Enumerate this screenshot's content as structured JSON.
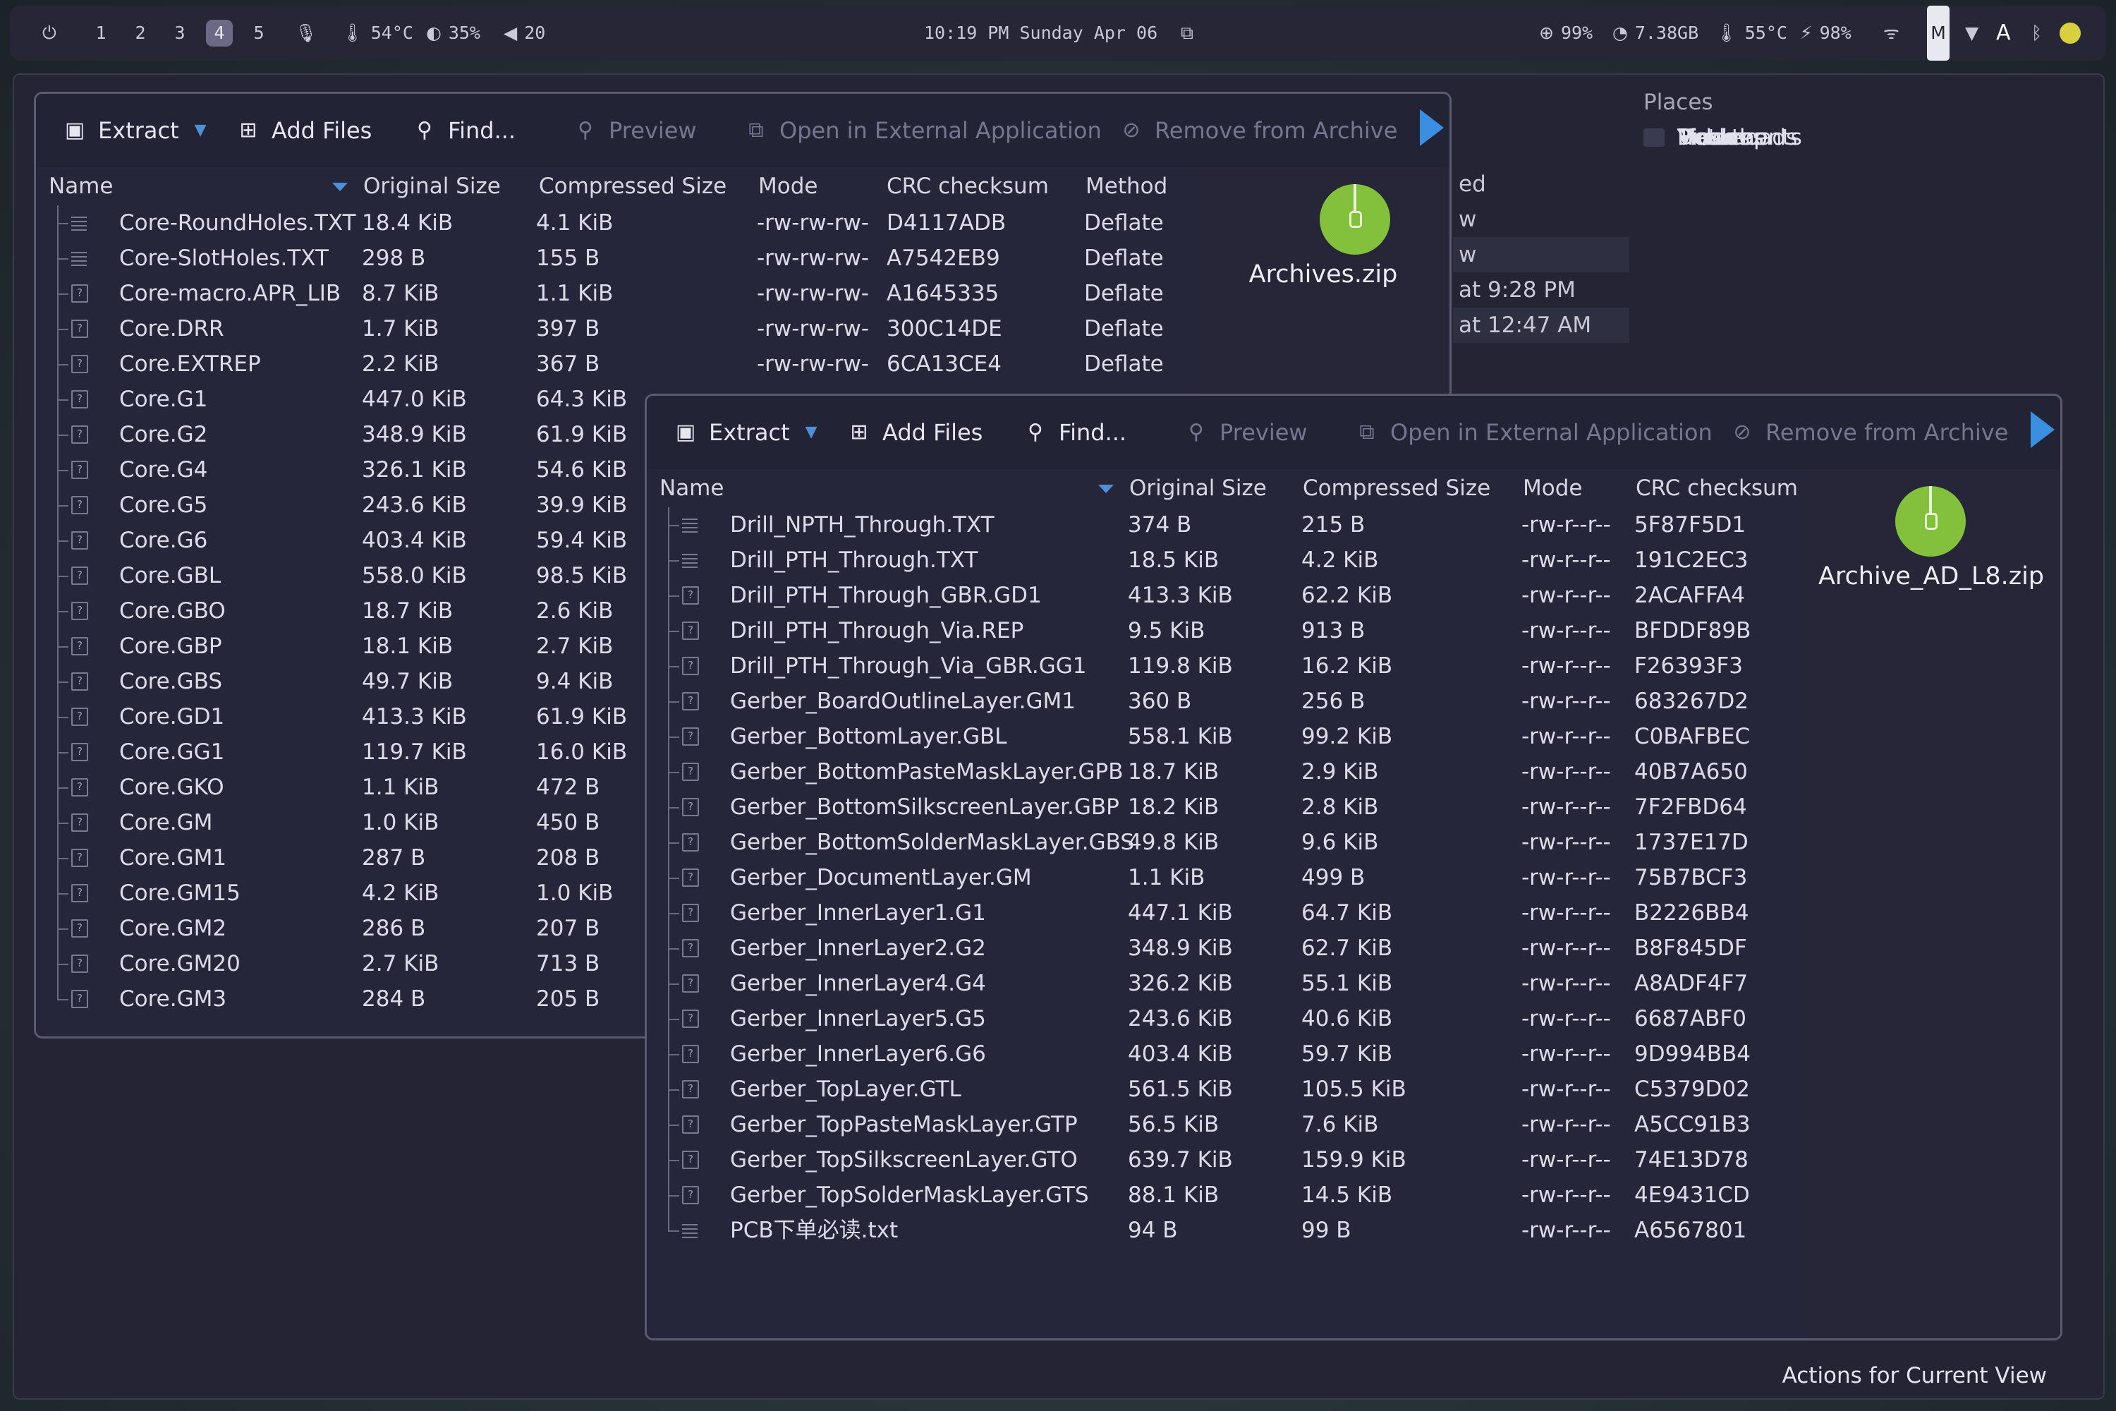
{
  "topbar": {
    "workspaces": [
      "1",
      "2",
      "3",
      "4",
      "5"
    ],
    "active_workspace": "4",
    "cpu_temp": "54°C",
    "brightness": "35%",
    "volume": "20",
    "clock": "10:19 PM Sunday Apr 06",
    "cpu_usage": "99%",
    "memory": "7.38GB",
    "gpu_temp": "55°C",
    "battery": "98%"
  },
  "file_manager": {
    "places_title": "Places",
    "places": [
      "Home",
      "Desktop",
      "Documents",
      "Downloads",
      "Music",
      "Pictures",
      "Videos",
      "Trash"
    ],
    "peek_rows": [
      "ed",
      "w",
      "w",
      "at 9:28 PM",
      "at 12:47 AM"
    ],
    "actions_label": "Actions for Current View"
  },
  "toolbar": {
    "extract": "Extract",
    "add_files": "Add Files",
    "find": "Find...",
    "preview": "Preview",
    "open_external": "Open in External Application",
    "remove": "Remove from Archive"
  },
  "archive1": {
    "name": "Archives.zip",
    "columns": [
      "Name",
      "Original Size",
      "Compressed Size",
      "Mode",
      "CRC checksum",
      "Method"
    ],
    "rows": [
      [
        "Core-RoundHoles.TXT",
        "18.4 KiB",
        "4.1 KiB",
        "-rw-rw-rw-",
        "D4117ADB",
        "Deflate"
      ],
      [
        "Core-SlotHoles.TXT",
        "298 B",
        "155 B",
        "-rw-rw-rw-",
        "A7542EB9",
        "Deflate"
      ],
      [
        "Core-macro.APR_LIB",
        "8.7 KiB",
        "1.1 KiB",
        "-rw-rw-rw-",
        "A1645335",
        "Deflate"
      ],
      [
        "Core.DRR",
        "1.7 KiB",
        "397 B",
        "-rw-rw-rw-",
        "300C14DE",
        "Deflate"
      ],
      [
        "Core.EXTREP",
        "2.2 KiB",
        "367 B",
        "-rw-rw-rw-",
        "6CA13CE4",
        "Deflate"
      ],
      [
        "Core.G1",
        "447.0 KiB",
        "64.3 KiB",
        "",
        "",
        ""
      ],
      [
        "Core.G2",
        "348.9 KiB",
        "61.9 KiB",
        "",
        "",
        ""
      ],
      [
        "Core.G4",
        "326.1 KiB",
        "54.6 KiB",
        "",
        "",
        ""
      ],
      [
        "Core.G5",
        "243.6 KiB",
        "39.9 KiB",
        "",
        "",
        ""
      ],
      [
        "Core.G6",
        "403.4 KiB",
        "59.4 KiB",
        "",
        "",
        ""
      ],
      [
        "Core.GBL",
        "558.0 KiB",
        "98.5 KiB",
        "",
        "",
        ""
      ],
      [
        "Core.GBO",
        "18.7 KiB",
        "2.6 KiB",
        "",
        "",
        ""
      ],
      [
        "Core.GBP",
        "18.1 KiB",
        "2.7 KiB",
        "",
        "",
        ""
      ],
      [
        "Core.GBS",
        "49.7 KiB",
        "9.4 KiB",
        "",
        "",
        ""
      ],
      [
        "Core.GD1",
        "413.3 KiB",
        "61.9 KiB",
        "",
        "",
        ""
      ],
      [
        "Core.GG1",
        "119.7 KiB",
        "16.0 KiB",
        "",
        "",
        ""
      ],
      [
        "Core.GKO",
        "1.1 KiB",
        "472 B",
        "",
        "",
        ""
      ],
      [
        "Core.GM",
        "1.0 KiB",
        "450 B",
        "",
        "",
        ""
      ],
      [
        "Core.GM1",
        "287 B",
        "208 B",
        "",
        "",
        ""
      ],
      [
        "Core.GM15",
        "4.2 KiB",
        "1.0 KiB",
        "",
        "",
        ""
      ],
      [
        "Core.GM2",
        "286 B",
        "207 B",
        "",
        "",
        ""
      ],
      [
        "Core.GM20",
        "2.7 KiB",
        "713 B",
        "",
        "",
        ""
      ],
      [
        "Core.GM3",
        "284 B",
        "205 B",
        "",
        "",
        ""
      ]
    ]
  },
  "archive2": {
    "name": "Archive_AD_L8.zip",
    "columns": [
      "Name",
      "Original Size",
      "Compressed Size",
      "Mode",
      "CRC checksum"
    ],
    "rows": [
      [
        "Drill_NPTH_Through.TXT",
        "374 B",
        "215 B",
        "-rw-r--r--",
        "5F87F5D1"
      ],
      [
        "Drill_PTH_Through.TXT",
        "18.5 KiB",
        "4.2 KiB",
        "-rw-r--r--",
        "191C2EC3"
      ],
      [
        "Drill_PTH_Through_GBR.GD1",
        "413.3 KiB",
        "62.2 KiB",
        "-rw-r--r--",
        "2ACAFFA4"
      ],
      [
        "Drill_PTH_Through_Via.REP",
        "9.5 KiB",
        "913 B",
        "-rw-r--r--",
        "BFDDF89B"
      ],
      [
        "Drill_PTH_Through_Via_GBR.GG1",
        "119.8 KiB",
        "16.2 KiB",
        "-rw-r--r--",
        "F26393F3"
      ],
      [
        "Gerber_BoardOutlineLayer.GM1",
        "360 B",
        "256 B",
        "-rw-r--r--",
        "683267D2"
      ],
      [
        "Gerber_BottomLayer.GBL",
        "558.1 KiB",
        "99.2 KiB",
        "-rw-r--r--",
        "C0BAFBEC"
      ],
      [
        "Gerber_BottomPasteMaskLayer.GPB",
        "18.7 KiB",
        "2.9 KiB",
        "-rw-r--r--",
        "40B7A650"
      ],
      [
        "Gerber_BottomSilkscreenLayer.GBP",
        "18.2 KiB",
        "2.8 KiB",
        "-rw-r--r--",
        "7F2FBD64"
      ],
      [
        "Gerber_BottomSolderMaskLayer.GBS",
        "49.8 KiB",
        "9.6 KiB",
        "-rw-r--r--",
        "1737E17D"
      ],
      [
        "Gerber_DocumentLayer.GM",
        "1.1 KiB",
        "499 B",
        "-rw-r--r--",
        "75B7BCF3"
      ],
      [
        "Gerber_InnerLayer1.G1",
        "447.1 KiB",
        "64.7 KiB",
        "-rw-r--r--",
        "B2226BB4"
      ],
      [
        "Gerber_InnerLayer2.G2",
        "348.9 KiB",
        "62.7 KiB",
        "-rw-r--r--",
        "B8F845DF"
      ],
      [
        "Gerber_InnerLayer4.G4",
        "326.2 KiB",
        "55.1 KiB",
        "-rw-r--r--",
        "A8ADF4F7"
      ],
      [
        "Gerber_InnerLayer5.G5",
        "243.6 KiB",
        "40.6 KiB",
        "-rw-r--r--",
        "6687ABF0"
      ],
      [
        "Gerber_InnerLayer6.G6",
        "403.4 KiB",
        "59.7 KiB",
        "-rw-r--r--",
        "9D994BB4"
      ],
      [
        "Gerber_TopLayer.GTL",
        "561.5 KiB",
        "105.5 KiB",
        "-rw-r--r--",
        "C5379D02"
      ],
      [
        "Gerber_TopPasteMaskLayer.GTP",
        "56.5 KiB",
        "7.6 KiB",
        "-rw-r--r--",
        "A5CC91B3"
      ],
      [
        "Gerber_TopSilkscreenLayer.GTO",
        "639.7 KiB",
        "159.9 KiB",
        "-rw-r--r--",
        "74E13D78"
      ],
      [
        "Gerber_TopSolderMaskLayer.GTS",
        "88.1 KiB",
        "14.5 KiB",
        "-rw-r--r--",
        "4E9431CD"
      ],
      [
        "PCB下单必读.txt",
        "94 B",
        "99 B",
        "-rw-r--r--",
        "A6567801"
      ]
    ]
  }
}
